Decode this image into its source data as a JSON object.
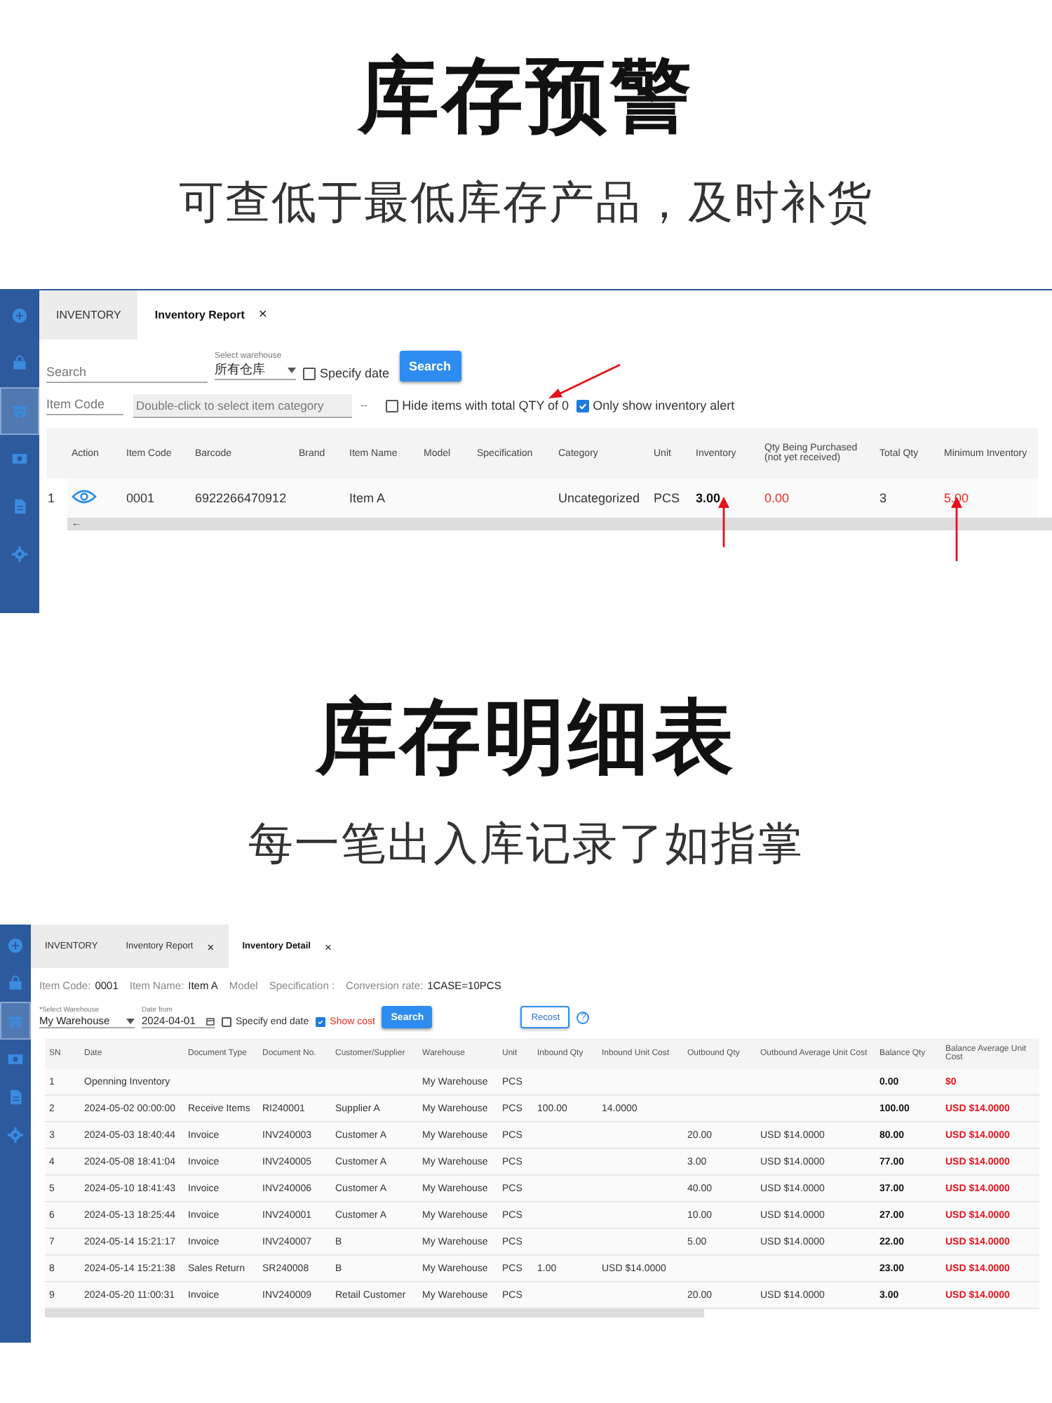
{
  "alert_section": {
    "title": "库存预警",
    "subtitle": "可查低于最低库存产品，及时补货",
    "app": {
      "sidebar": {
        "items": [
          {
            "selected": false
          },
          {
            "selected": false
          },
          {
            "selected": true
          },
          {
            "selected": false
          },
          {
            "selected": false
          },
          {
            "selected": false
          }
        ]
      },
      "tabs": [
        {
          "label": "INVENTORY",
          "selected": false
        },
        {
          "label": "Inventory Report",
          "selected": true,
          "close": "×"
        }
      ],
      "search": {
        "placeholder": "Search"
      },
      "warehouse": {
        "label": "Select warehouse",
        "value": "所有仓库"
      },
      "specify_date": {
        "label": "Specify date",
        "checked": false
      },
      "search_button": "Search",
      "item_code": {
        "placeholder": "Item Code"
      },
      "category": {
        "placeholder": "Double-click to select item category"
      },
      "range_separator": "--",
      "hide_zero": {
        "label": "Hide items with total QTY of 0",
        "checked": false
      },
      "only_alert": {
        "label": "Only show inventory alert",
        "checked": true
      },
      "table": {
        "columns": [
          {
            "label": "Action"
          },
          {
            "label": "Item Code",
            "bold": false,
            "alert": false
          },
          {
            "label": "Barcode",
            "bold": false,
            "alert": false
          },
          {
            "label": "Brand"
          },
          {
            "label": "Item Name",
            "bold": false,
            "alert": false
          },
          {
            "label": "Model"
          },
          {
            "label": "Specification"
          },
          {
            "label": "Category",
            "bold": false,
            "alert": false
          },
          {
            "label": "Unit",
            "bold": false,
            "alert": false
          },
          {
            "label": "Inventory",
            "bold": true,
            "alert": false
          },
          {
            "label": "Qty Being Purchased (not yet received)",
            "bold": false,
            "alert": true
          },
          {
            "label": "Total Qty",
            "bold": false,
            "alert": false
          },
          {
            "label": "Minimum Inventory",
            "bold": false,
            "alert": true
          }
        ],
        "rows": [
          {
            "sn": "1",
            "cells": [
              null,
              "0001",
              "6922266470912",
              null,
              "Item A",
              null,
              null,
              "Uncategorized",
              "PCS",
              "3.00",
              "0.00",
              "3",
              "5.00"
            ]
          }
        ],
        "scroll_arrow": "←"
      }
    }
  },
  "detail_section": {
    "title": "库存明细表",
    "subtitle": "每一笔出入库记录了如指掌",
    "app": {
      "sidebar": {
        "items": [
          {
            "selected": false
          },
          {
            "selected": false
          },
          {
            "selected": true
          },
          {
            "selected": false
          },
          {
            "selected": false
          },
          {
            "selected": false
          }
        ]
      },
      "tabs": [
        {
          "label": "INVENTORY",
          "selected": false
        },
        {
          "label": "Inventory Report",
          "selected": false,
          "close": "×"
        },
        {
          "label": "Inventory Detail",
          "selected": true,
          "close": "×"
        }
      ],
      "info": [
        {
          "label": "Item Code:",
          "value": "0001"
        },
        {
          "label": "Item Name:",
          "value": "Item A"
        },
        {
          "label": "Model"
        },
        {
          "label": "Specification :"
        },
        {
          "label": "Conversion rate:",
          "value": "1CASE=10PCS"
        }
      ],
      "warehouse": {
        "label": "*Select Warehouse",
        "value": "My Warehouse"
      },
      "date_from": {
        "label": "Date from",
        "value": "2024-04-01"
      },
      "specify_end_date": {
        "label": "Specify end date",
        "checked": false
      },
      "show_cost": {
        "label": "Show cost",
        "checked": true
      },
      "search_button": "Search",
      "recost_button": "Recost",
      "help": "?",
      "table": {
        "columns": [
          {
            "label": "SN",
            "bold": false,
            "alert": false
          },
          {
            "label": "Date",
            "bold": false,
            "alert": false
          },
          {
            "label": "Document Type",
            "bold": false,
            "alert": false
          },
          {
            "label": "Document No.",
            "bold": false,
            "alert": false
          },
          {
            "label": "Customer/Supplier",
            "bold": false,
            "alert": false
          },
          {
            "label": "Warehouse",
            "bold": false,
            "alert": false
          },
          {
            "label": "Unit",
            "bold": false,
            "alert": false
          },
          {
            "label": "Inbound Qty",
            "bold": false,
            "alert": false
          },
          {
            "label": "Inbound Unit Cost",
            "bold": false,
            "alert": false
          },
          {
            "label": "Outbound Qty",
            "bold": false,
            "alert": false
          },
          {
            "label": "Outbound Average Unit Cost",
            "bold": false,
            "alert": false
          },
          {
            "label": "Balance Qty",
            "bold": true,
            "alert": false
          },
          {
            "label": "Balance Average Unit Cost",
            "bold": true,
            "alert": true
          }
        ],
        "rows": [
          [
            "1",
            "Openning Inventory",
            null,
            null,
            null,
            "My Warehouse",
            "PCS",
            null,
            null,
            null,
            null,
            "0.00",
            "$0"
          ],
          [
            "2",
            "2024-05-02 00:00:00",
            "Receive Items",
            "RI240001",
            "Supplier A",
            "My Warehouse",
            "PCS",
            "100.00",
            "14.0000",
            null,
            null,
            "100.00",
            "USD $14.0000"
          ],
          [
            "3",
            "2024-05-03 18:40:44",
            "Invoice",
            "INV240003",
            "Customer A",
            "My Warehouse",
            "PCS",
            null,
            null,
            "20.00",
            "USD $14.0000",
            "80.00",
            "USD $14.0000"
          ],
          [
            "4",
            "2024-05-08 18:41:04",
            "Invoice",
            "INV240005",
            "Customer A",
            "My Warehouse",
            "PCS",
            null,
            null,
            "3.00",
            "USD $14.0000",
            "77.00",
            "USD $14.0000"
          ],
          [
            "5",
            "2024-05-10 18:41:43",
            "Invoice",
            "INV240006",
            "Customer A",
            "My Warehouse",
            "PCS",
            null,
            null,
            "40.00",
            "USD $14.0000",
            "37.00",
            "USD $14.0000"
          ],
          [
            "6",
            "2024-05-13 18:25:44",
            "Invoice",
            "INV240001",
            "Customer A",
            "My Warehouse",
            "PCS",
            null,
            null,
            "10.00",
            "USD $14.0000",
            "27.00",
            "USD $14.0000"
          ],
          [
            "7",
            "2024-05-14 15:21:17",
            "Invoice",
            "INV240007",
            "B",
            "My Warehouse",
            "PCS",
            null,
            null,
            "5.00",
            "USD $14.0000",
            "22.00",
            "USD $14.0000"
          ],
          [
            "8",
            "2024-05-14 15:21:38",
            "Sales Return",
            "SR240008",
            "B",
            "My Warehouse",
            "PCS",
            "1.00",
            "USD $14.0000",
            null,
            null,
            "23.00",
            "USD $14.0000"
          ],
          [
            "9",
            "2024-05-20 11:00:31",
            "Invoice",
            "INV240009",
            "Retail Customer",
            "My Warehouse",
            "PCS",
            null,
            null,
            "20.00",
            "USD $14.0000",
            "3.00",
            "USD $14.0000"
          ]
        ]
      }
    }
  }
}
